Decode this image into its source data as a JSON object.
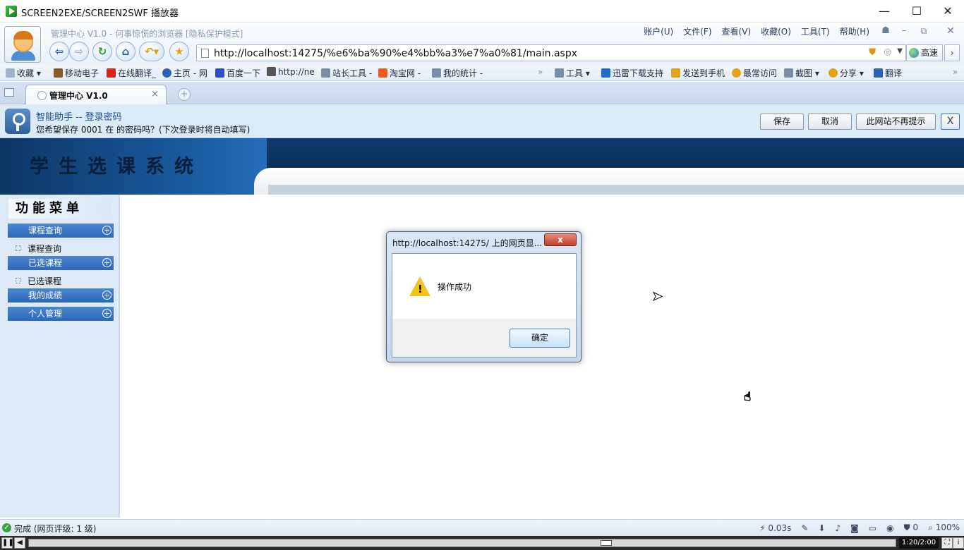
{
  "player": {
    "title": "SCREEN2EXE/SCREEN2SWF 播放器",
    "minimize": "—",
    "maximize": "☐",
    "close": "✕",
    "time": "1:20/2:00"
  },
  "browser": {
    "caption": "管理中心 V1.0 - 何事惊慌的浏览器 [隐私保护模式]",
    "menu": [
      "账户(U)",
      "文件(F)",
      "查看(V)",
      "收藏(O)",
      "工具(T)",
      "帮助(H)"
    ],
    "url": "http://localhost:14275/%e6%ba%90%e4%bb%a3%e7%a0%81/main.aspx",
    "speed_label": "高速",
    "favorites": [
      {
        "label": "收藏",
        "color": "#9fb3cc"
      },
      {
        "label": "移动电子",
        "color": "#8a5a2b"
      },
      {
        "label": "在线翻译_",
        "color": "#e0201b"
      },
      {
        "label": "主页 - 网",
        "color": "#2a62b8"
      },
      {
        "label": "百度一下",
        "color": "#2a4fc7"
      },
      {
        "label": "http://ne",
        "color": "#555555"
      },
      {
        "label": "站长工具 -",
        "color": "#7a8ea8"
      },
      {
        "label": "淘宝网 -",
        "color": "#f25a1a"
      },
      {
        "label": "我的统计 -",
        "color": "#7a8ea8"
      },
      {
        "label": "工具",
        "color": "#7a8ea8"
      },
      {
        "label": "迅雷下载支持",
        "color": "#1d6fc7"
      },
      {
        "label": "发送到手机",
        "color": "#e2a21a"
      },
      {
        "label": "最常访问",
        "color": "#e2a21a"
      },
      {
        "label": "截图",
        "color": "#7a8ea8"
      },
      {
        "label": "分享",
        "color": "#e2a21a"
      },
      {
        "label": "翻译",
        "color": "#2a62b8"
      }
    ],
    "tab_label": "管理中心 V1.0",
    "tab_close": "×",
    "new_tab": "+"
  },
  "assistant": {
    "title": "智能助手 -- 登录密码",
    "message": "您希望保存 0001 在  的密码吗？(下次登录时将自动填写)",
    "save": "保存",
    "cancel": "取消",
    "never": "此网站不再提示",
    "close": "X"
  },
  "page": {
    "system_title": "学生选课系统",
    "menu_title": "功能菜单",
    "menu": {
      "course_query_head": "课程查询",
      "course_query_item": "课程查询",
      "selected_head": "已选课程",
      "selected_item": "已选课程",
      "grades_head": "我的成绩",
      "personal_head": "个人管理",
      "plus": "+"
    }
  },
  "dialog": {
    "title": "http://localhost:14275/ 上的网页显...",
    "close": "x",
    "message": "操作成功",
    "ok": "确定",
    "warn_mark": "!"
  },
  "status": {
    "text": "完成 (网页评级: 1 级)",
    "load_time": "0.03s",
    "count": "0",
    "zoom": "100%"
  }
}
